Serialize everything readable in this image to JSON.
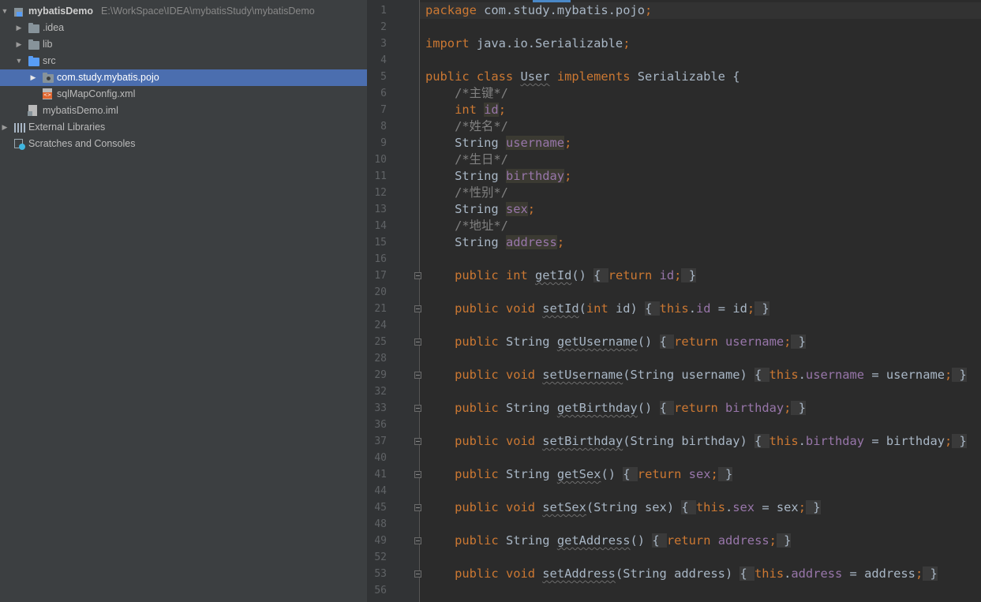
{
  "project_tree": [
    {
      "label": "mybatisDemo",
      "path": "E:\\WorkSpace\\IDEA\\mybatisStudy\\mybatisDemo",
      "icon": "module-icon",
      "arrow": "expanded",
      "indent": 0
    },
    {
      "label": ".idea",
      "icon": "folder-icon",
      "arrow": "collapsed",
      "indent": 1
    },
    {
      "label": "lib",
      "icon": "folder-icon",
      "arrow": "collapsed",
      "indent": 1
    },
    {
      "label": "src",
      "icon": "source-folder-icon",
      "arrow": "expanded",
      "indent": 1
    },
    {
      "label": "com.study.mybatis.pojo",
      "icon": "package-icon",
      "arrow": "collapsed",
      "indent": 2,
      "selected": true
    },
    {
      "label": "sqlMapConfig.xml",
      "icon": "xml-file-icon",
      "arrow": "none",
      "indent": 2
    },
    {
      "label": "mybatisDemo.iml",
      "icon": "iml-file-icon",
      "arrow": "none",
      "indent": 1
    },
    {
      "label": "External Libraries",
      "icon": "library-icon",
      "arrow": "collapsed",
      "indent": 0
    },
    {
      "label": "Scratches and Consoles",
      "icon": "scratches-icon",
      "arrow": "none",
      "indent": 0
    }
  ],
  "editor": {
    "line_numbers": [
      "1",
      "2",
      "3",
      "4",
      "5",
      "6",
      "7",
      "8",
      "9",
      "10",
      "11",
      "12",
      "13",
      "14",
      "15",
      "16",
      "17",
      "20",
      "21",
      "24",
      "25",
      "28",
      "29",
      "32",
      "33",
      "36",
      "37",
      "40",
      "41",
      "44",
      "45",
      "48",
      "49",
      "52",
      "53",
      "56"
    ],
    "fold_markers_on_lines": [
      "17",
      "21",
      "25",
      "29",
      "33",
      "37",
      "41",
      "45",
      "49",
      "53"
    ],
    "code": [
      {
        "t": [
          {
            "s": "package ",
            "c": "kw"
          },
          {
            "s": "com.study.mybatis.pojo"
          },
          {
            "s": ";",
            "c": "kw"
          }
        ]
      },
      {
        "t": []
      },
      {
        "t": [
          {
            "s": "import ",
            "c": "kw"
          },
          {
            "s": "java.io.Serializable"
          },
          {
            "s": ";",
            "c": "kw"
          }
        ]
      },
      {
        "t": []
      },
      {
        "t": [
          {
            "s": "public class ",
            "c": "kw"
          },
          {
            "s": "User",
            "c": "sq"
          },
          {
            "s": " implements ",
            "c": "kw"
          },
          {
            "s": "Serializable {"
          }
        ]
      },
      {
        "t": [
          {
            "s": "    /*主键*/",
            "c": "cmt"
          }
        ]
      },
      {
        "t": [
          {
            "s": "    "
          },
          {
            "s": "int ",
            "c": "kw"
          },
          {
            "s": "id",
            "c": "fld hl"
          },
          {
            "s": ";",
            "c": "kw"
          }
        ]
      },
      {
        "t": [
          {
            "s": "    /*姓名*/",
            "c": "cmt"
          }
        ]
      },
      {
        "t": [
          {
            "s": "    String "
          },
          {
            "s": "username",
            "c": "fld hl"
          },
          {
            "s": ";",
            "c": "kw"
          }
        ]
      },
      {
        "t": [
          {
            "s": "    /*生日*/",
            "c": "cmt"
          }
        ]
      },
      {
        "t": [
          {
            "s": "    String "
          },
          {
            "s": "birthday",
            "c": "fld hl"
          },
          {
            "s": ";",
            "c": "kw"
          }
        ]
      },
      {
        "t": [
          {
            "s": "    /*性别*/",
            "c": "cmt"
          }
        ]
      },
      {
        "t": [
          {
            "s": "    String "
          },
          {
            "s": "sex",
            "c": "fld hl"
          },
          {
            "s": ";",
            "c": "kw"
          }
        ]
      },
      {
        "t": [
          {
            "s": "    /*地址*/",
            "c": "cmt"
          }
        ]
      },
      {
        "t": [
          {
            "s": "    String "
          },
          {
            "s": "address",
            "c": "fld hl"
          },
          {
            "s": ";",
            "c": "kw"
          }
        ]
      },
      {
        "t": []
      },
      {
        "t": [
          {
            "s": "    "
          },
          {
            "s": "public int ",
            "c": "kw"
          },
          {
            "s": "getId",
            "c": "sq"
          },
          {
            "s": "() "
          },
          {
            "s": "{ ",
            "c": "bb"
          },
          {
            "s": "return ",
            "c": "kw"
          },
          {
            "s": "id",
            "c": "fld"
          },
          {
            "s": ";",
            "c": "kw"
          },
          {
            "s": " }",
            "c": "bb"
          }
        ]
      },
      {
        "t": []
      },
      {
        "t": [
          {
            "s": "    "
          },
          {
            "s": "public void ",
            "c": "kw"
          },
          {
            "s": "setId",
            "c": "sq"
          },
          {
            "s": "("
          },
          {
            "s": "int ",
            "c": "kw"
          },
          {
            "s": "id) "
          },
          {
            "s": "{ ",
            "c": "bb"
          },
          {
            "s": "this",
            "c": "kw"
          },
          {
            "s": "."
          },
          {
            "s": "id",
            "c": "fld"
          },
          {
            "s": " = id"
          },
          {
            "s": ";",
            "c": "kw"
          },
          {
            "s": " }",
            "c": "bb"
          }
        ]
      },
      {
        "t": []
      },
      {
        "t": [
          {
            "s": "    "
          },
          {
            "s": "public ",
            "c": "kw"
          },
          {
            "s": "String "
          },
          {
            "s": "getUsername",
            "c": "sq"
          },
          {
            "s": "() "
          },
          {
            "s": "{ ",
            "c": "bb"
          },
          {
            "s": "return ",
            "c": "kw"
          },
          {
            "s": "username",
            "c": "fld"
          },
          {
            "s": ";",
            "c": "kw"
          },
          {
            "s": " }",
            "c": "bb"
          }
        ]
      },
      {
        "t": []
      },
      {
        "t": [
          {
            "s": "    "
          },
          {
            "s": "public void ",
            "c": "kw"
          },
          {
            "s": "setUsername",
            "c": "sq"
          },
          {
            "s": "(String username) "
          },
          {
            "s": "{ ",
            "c": "bb"
          },
          {
            "s": "this",
            "c": "kw"
          },
          {
            "s": "."
          },
          {
            "s": "username",
            "c": "fld"
          },
          {
            "s": " = username"
          },
          {
            "s": ";",
            "c": "kw"
          },
          {
            "s": " }",
            "c": "bb"
          }
        ]
      },
      {
        "t": []
      },
      {
        "t": [
          {
            "s": "    "
          },
          {
            "s": "public ",
            "c": "kw"
          },
          {
            "s": "String "
          },
          {
            "s": "getBirthday",
            "c": "sq"
          },
          {
            "s": "() "
          },
          {
            "s": "{ ",
            "c": "bb"
          },
          {
            "s": "return ",
            "c": "kw"
          },
          {
            "s": "birthday",
            "c": "fld"
          },
          {
            "s": ";",
            "c": "kw"
          },
          {
            "s": " }",
            "c": "bb"
          }
        ]
      },
      {
        "t": []
      },
      {
        "t": [
          {
            "s": "    "
          },
          {
            "s": "public void ",
            "c": "kw"
          },
          {
            "s": "setBirthday",
            "c": "sq"
          },
          {
            "s": "(String birthday) "
          },
          {
            "s": "{ ",
            "c": "bb"
          },
          {
            "s": "this",
            "c": "kw"
          },
          {
            "s": "."
          },
          {
            "s": "birthday",
            "c": "fld"
          },
          {
            "s": " = birthday"
          },
          {
            "s": ";",
            "c": "kw"
          },
          {
            "s": " }",
            "c": "bb"
          }
        ]
      },
      {
        "t": []
      },
      {
        "t": [
          {
            "s": "    "
          },
          {
            "s": "public ",
            "c": "kw"
          },
          {
            "s": "String "
          },
          {
            "s": "getSex",
            "c": "sq"
          },
          {
            "s": "() "
          },
          {
            "s": "{ ",
            "c": "bb"
          },
          {
            "s": "return ",
            "c": "kw"
          },
          {
            "s": "sex",
            "c": "fld"
          },
          {
            "s": ";",
            "c": "kw"
          },
          {
            "s": " }",
            "c": "bb"
          }
        ]
      },
      {
        "t": []
      },
      {
        "t": [
          {
            "s": "    "
          },
          {
            "s": "public void ",
            "c": "kw"
          },
          {
            "s": "setSex",
            "c": "sq"
          },
          {
            "s": "(String sex) "
          },
          {
            "s": "{ ",
            "c": "bb"
          },
          {
            "s": "this",
            "c": "kw"
          },
          {
            "s": "."
          },
          {
            "s": "sex",
            "c": "fld"
          },
          {
            "s": " = sex"
          },
          {
            "s": ";",
            "c": "kw"
          },
          {
            "s": " }",
            "c": "bb"
          }
        ]
      },
      {
        "t": []
      },
      {
        "t": [
          {
            "s": "    "
          },
          {
            "s": "public ",
            "c": "kw"
          },
          {
            "s": "String "
          },
          {
            "s": "getAddress",
            "c": "sq"
          },
          {
            "s": "() "
          },
          {
            "s": "{ ",
            "c": "bb"
          },
          {
            "s": "return ",
            "c": "kw"
          },
          {
            "s": "address",
            "c": "fld"
          },
          {
            "s": ";",
            "c": "kw"
          },
          {
            "s": " }",
            "c": "bb"
          }
        ]
      },
      {
        "t": []
      },
      {
        "t": [
          {
            "s": "    "
          },
          {
            "s": "public void ",
            "c": "kw"
          },
          {
            "s": "setAddress",
            "c": "sq"
          },
          {
            "s": "(String address) "
          },
          {
            "s": "{ ",
            "c": "bb"
          },
          {
            "s": "this",
            "c": "kw"
          },
          {
            "s": "."
          },
          {
            "s": "address",
            "c": "fld"
          },
          {
            "s": " = address"
          },
          {
            "s": ";",
            "c": "kw"
          },
          {
            "s": " }",
            "c": "bb"
          }
        ]
      },
      {
        "t": []
      }
    ]
  },
  "colors": {
    "panel_bg": "#3c3f41",
    "editor_bg": "#2b2b2b",
    "gutter_bg": "#313335",
    "selection": "#4b6eaf",
    "keyword": "#cc7832",
    "field": "#9876aa",
    "comment": "#808080",
    "text": "#a9b7c6",
    "line_number": "#606366"
  }
}
